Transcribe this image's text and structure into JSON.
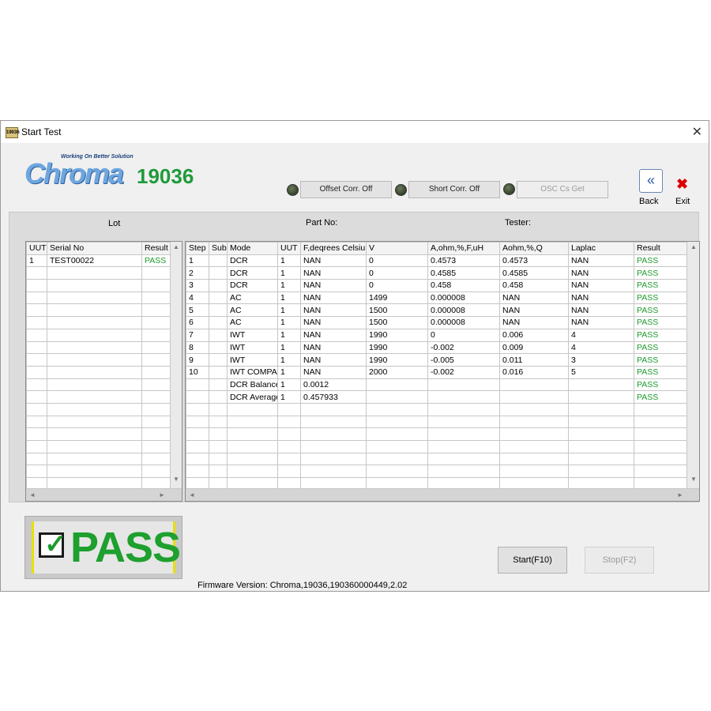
{
  "window": {
    "icon_text": "19036",
    "title": "Start Test",
    "close_glyph": "✕"
  },
  "header": {
    "logo_tagline": "Working On Better Solution",
    "logo_word": "Chroma",
    "model": "19036",
    "offset_corr": "Offset Corr. Off",
    "short_corr": "Short Corr. Off",
    "osc_get": "OSC Cs Get",
    "back_label": "Back",
    "exit_label": "Exit",
    "back_icon": "double-chevron-left-icon",
    "exit_icon": "close-icon"
  },
  "labels": {
    "lot": "Lot",
    "part_no": "Part No:",
    "tester": "Tester:"
  },
  "uut_table": {
    "columns": [
      "UUT",
      "Serial No",
      "Result"
    ],
    "rows": [
      [
        "1",
        "TEST00022",
        "PASS"
      ]
    ]
  },
  "step_table": {
    "columns": [
      "Step",
      "Sub",
      "Mode",
      "UUT",
      "F,deqrees Celsiu",
      "V",
      "A,ohm,%,F,uH",
      "Aohm,%,Q",
      "Laplac",
      "Result"
    ],
    "rows": [
      [
        "1",
        "",
        "DCR",
        "1",
        "NAN",
        "0",
        "0.4573",
        "0.4573",
        "NAN",
        "PASS"
      ],
      [
        "2",
        "",
        "DCR",
        "1",
        "NAN",
        "0",
        "0.4585",
        "0.4585",
        "NAN",
        "PASS"
      ],
      [
        "3",
        "",
        "DCR",
        "1",
        "NAN",
        "0",
        "0.458",
        "0.458",
        "NAN",
        "PASS"
      ],
      [
        "4",
        "",
        "AC",
        "1",
        "NAN",
        "1499",
        "0.000008",
        "NAN",
        "NAN",
        "PASS"
      ],
      [
        "5",
        "",
        "AC",
        "1",
        "NAN",
        "1500",
        "0.000008",
        "NAN",
        "NAN",
        "PASS"
      ],
      [
        "6",
        "",
        "AC",
        "1",
        "NAN",
        "1500",
        "0.000008",
        "NAN",
        "NAN",
        "PASS"
      ],
      [
        "7",
        "",
        "IWT",
        "1",
        "NAN",
        "1990",
        "0",
        "0.006",
        "4",
        "PASS"
      ],
      [
        "8",
        "",
        "IWT",
        "1",
        "NAN",
        "1990",
        "-0.002",
        "0.009",
        "4",
        "PASS"
      ],
      [
        "9",
        "",
        "IWT",
        "1",
        "NAN",
        "1990",
        "-0.005",
        "0.011",
        "3",
        "PASS"
      ],
      [
        "10",
        "",
        "IWT COMPA",
        "1",
        "NAN",
        "2000",
        "-0.002",
        "0.016",
        "5",
        "PASS"
      ],
      [
        "",
        "",
        "DCR Balance",
        "1",
        "0.0012",
        "",
        "",
        "",
        "",
        "PASS"
      ],
      [
        "",
        "",
        "DCR Average",
        "1",
        "0.457933",
        "",
        "",
        "",
        "",
        "PASS"
      ]
    ]
  },
  "result": {
    "text": "PASS",
    "check_glyph": "✓"
  },
  "actions": {
    "start": "Start(F10)",
    "stop": "Stop(F2)"
  },
  "firmware": "Firmware Version: Chroma,19036,190360000449,2.02",
  "colors": {
    "pass": "#1d9a2d",
    "logo_blue": "#6ea6de",
    "model_green": "#1f9a3a",
    "exit_red": "#dd0000"
  }
}
